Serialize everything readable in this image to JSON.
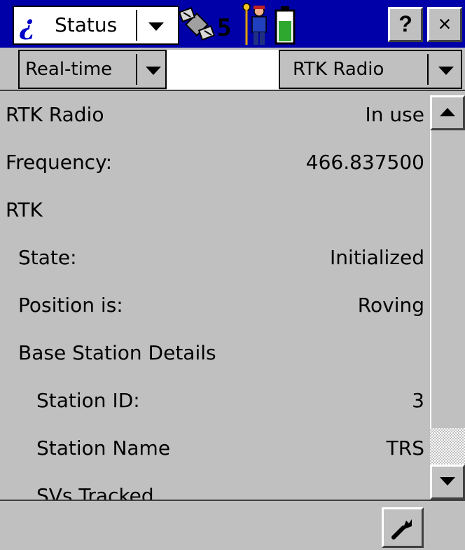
{
  "titlebar": {
    "app_label": "Status",
    "satellite_count": "5",
    "help_label": "?",
    "close_label": "×"
  },
  "selectors": {
    "mode": "Real-time",
    "source": "RTK Radio"
  },
  "rows": [
    {
      "label": "RTK Radio",
      "value": "In use"
    },
    {
      "label": "Frequency:",
      "value": "466.837500"
    },
    {
      "label": "RTK",
      "value": ""
    },
    {
      "label": "State:",
      "value": "Initialized"
    },
    {
      "label": "Position is:",
      "value": "Roving"
    },
    {
      "label": "Base Station Details",
      "value": ""
    },
    {
      "label": "Station ID:",
      "value": "3"
    },
    {
      "label": "Station Name",
      "value": "TRS"
    },
    {
      "label": "SVs Tracked",
      "value": ""
    }
  ],
  "icons": {
    "info": "info-icon",
    "satellite": "satellite-icon",
    "rover": "rover-surveyor-icon",
    "battery": "battery-icon",
    "wrench": "wrench-icon"
  },
  "colors": {
    "title_bar": "#0000a8",
    "window": "#c0c0c0",
    "battery_fill": "#2fa82f"
  }
}
